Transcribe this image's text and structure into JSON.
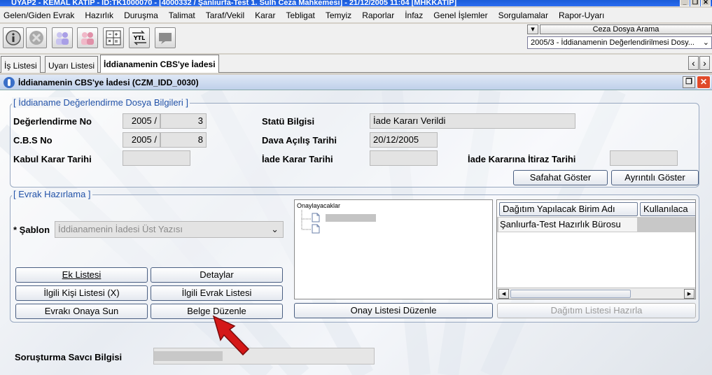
{
  "window": {
    "title": "UYAP2 - KEMAL KATIP - ID:TK1000070 - [4000332 / Şanlıurfa-Test 1. Sulh Ceza Mahkemesi] - 21/12/2005 11:04 [MHKKATIP]"
  },
  "menu": {
    "items": [
      "Gelen/Giden Evrak",
      "Hazırlık",
      "Duruşma",
      "Talimat",
      "Taraf/Vekil",
      "Karar",
      "Tebligat",
      "Temyiz",
      "Raporlar",
      "İnfaz",
      "Genel İşlemler",
      "Sorgulamalar",
      "Rapor-Uyarı"
    ]
  },
  "toolbar": {
    "icons": [
      "info-icon",
      "stop-icon",
      "users-icon",
      "user-group-icon",
      "calculator-icon",
      "ytl-converter-icon",
      "message-icon"
    ],
    "ytl_label": "YTL"
  },
  "search": {
    "button_label": "Ceza Dosya Arama",
    "selected": "2005/3 - İddianamenin Değerlendirilmesi Dosy..."
  },
  "tabs": {
    "items": [
      "İş Listesi",
      "Uyarı Listesi",
      "İddianamenin CBS'ye İadesi"
    ],
    "active": 2
  },
  "inner_window": {
    "title": "İddianamenin CBS'ye İadesi  (CZM_IDD_0030)"
  },
  "section1": {
    "title": "[ İddianame Değerlendirme Dosya Bilgileri ]",
    "degerlendirme_no_label": "Değerlendirme No",
    "degerlendirme_year": "2005 /",
    "degerlendirme_num": "3",
    "cbs_no_label": "C.B.S No",
    "cbs_year": "2005 /",
    "cbs_num": "8",
    "kabul_label": "Kabul Karar Tarihi",
    "kabul_value": "",
    "statu_label": "Statü Bilgisi",
    "statu_value": "İade Kararı Verildi",
    "dava_label": "Dava Açılış Tarihi",
    "dava_value": "20/12/2005",
    "iade_label": "İade Karar Tarihi",
    "iade_value": "",
    "itiraz_label": "İade Kararına İtiraz Tarihi",
    "itiraz_value": "",
    "safahat_button": "Safahat Göster",
    "ayrintili_button": "Ayrıntılı Göster"
  },
  "section2": {
    "title": "[ Evrak Hazırlama ]",
    "sablon_label": "* Şablon",
    "sablon_value": "İddianamenin İadesi Üst Yazısı",
    "buttons": {
      "ek_listesi": "Ek Listesi",
      "detaylar": "Detaylar",
      "ilgili_kisi": "İlgili Kişi Listesi (X)",
      "ilgili_evrak": "İlgili Evrak Listesi",
      "onaya_sun": "Evrakı Onaya Sun",
      "belge_duzenle": "Belge Düzenle",
      "onay_listesi": "Onay Listesi Düzenle",
      "dagitim_hazirla": "Dağıtım Listesi Hazırla"
    },
    "tree_root": "Onaylayacaklar",
    "grid": {
      "columns": [
        "Dağıtım Yapılacak Birim Adı",
        "Kullanılaca"
      ],
      "rows": [
        [
          "Şanlıurfa-Test Hazırlık Bürosu",
          ""
        ]
      ]
    }
  },
  "bottom": {
    "savci_label": "Soruşturma Savcı Bilgisi",
    "savci_value": ""
  },
  "colors": {
    "accent": "#2252a8",
    "arrow": "#d41818"
  }
}
